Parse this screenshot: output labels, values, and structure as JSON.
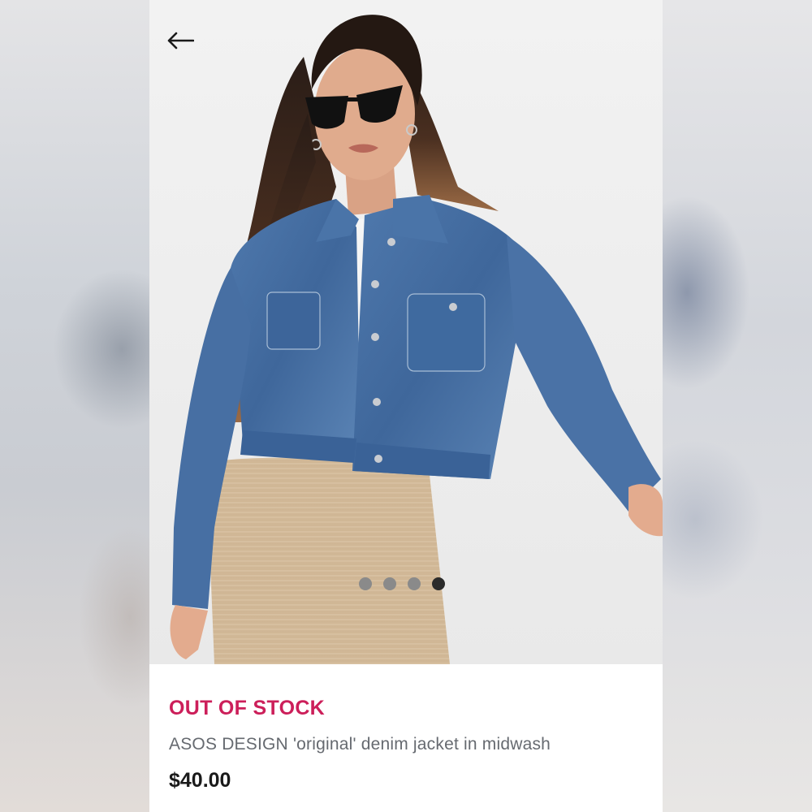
{
  "header": {
    "back_icon": "arrow-left-icon"
  },
  "product": {
    "image_alt": "ASOS DESIGN 'original' denim jacket in midwash",
    "stock_status": "OUT OF STOCK",
    "title": "ASOS DESIGN 'original' denim jacket in midwash",
    "price": "$40.00"
  },
  "carousel": {
    "count": 4,
    "active_index": 3
  },
  "colors": {
    "stock_status": "#cc1f5a",
    "title": "#666a70",
    "price": "#1a1a1a",
    "dot": "#8a8a8a",
    "dot_active": "#2b2b2b"
  }
}
